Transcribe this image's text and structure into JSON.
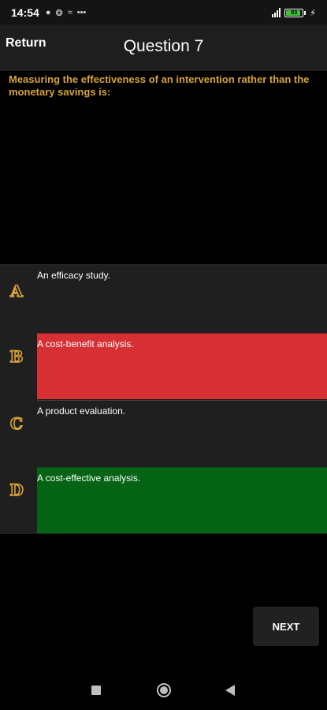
{
  "status_bar": {
    "time": "14:54",
    "battery": "83"
  },
  "header": {
    "return_label": "Return",
    "title": "Question 7"
  },
  "question": {
    "text": "Measuring the effectiveness of an intervention rather than the monetary savings is:",
    "color": "#d7a335"
  },
  "options": [
    {
      "letter": "A",
      "text": "An efficacy study.",
      "state": "plain"
    },
    {
      "letter": "B",
      "text": "A cost-benefit analysis.",
      "state": "wrong",
      "color": "#d63035"
    },
    {
      "letter": "C",
      "text": "A product evaluation.",
      "state": "plain"
    },
    {
      "letter": "D",
      "text": "A cost-effective analysis.",
      "state": "correct",
      "color": "#046314"
    }
  ],
  "next_label": "NEXT",
  "icons": {
    "nav_recents": "square-icon",
    "nav_home": "circle-icon",
    "nav_back": "triangle-back-icon"
  }
}
